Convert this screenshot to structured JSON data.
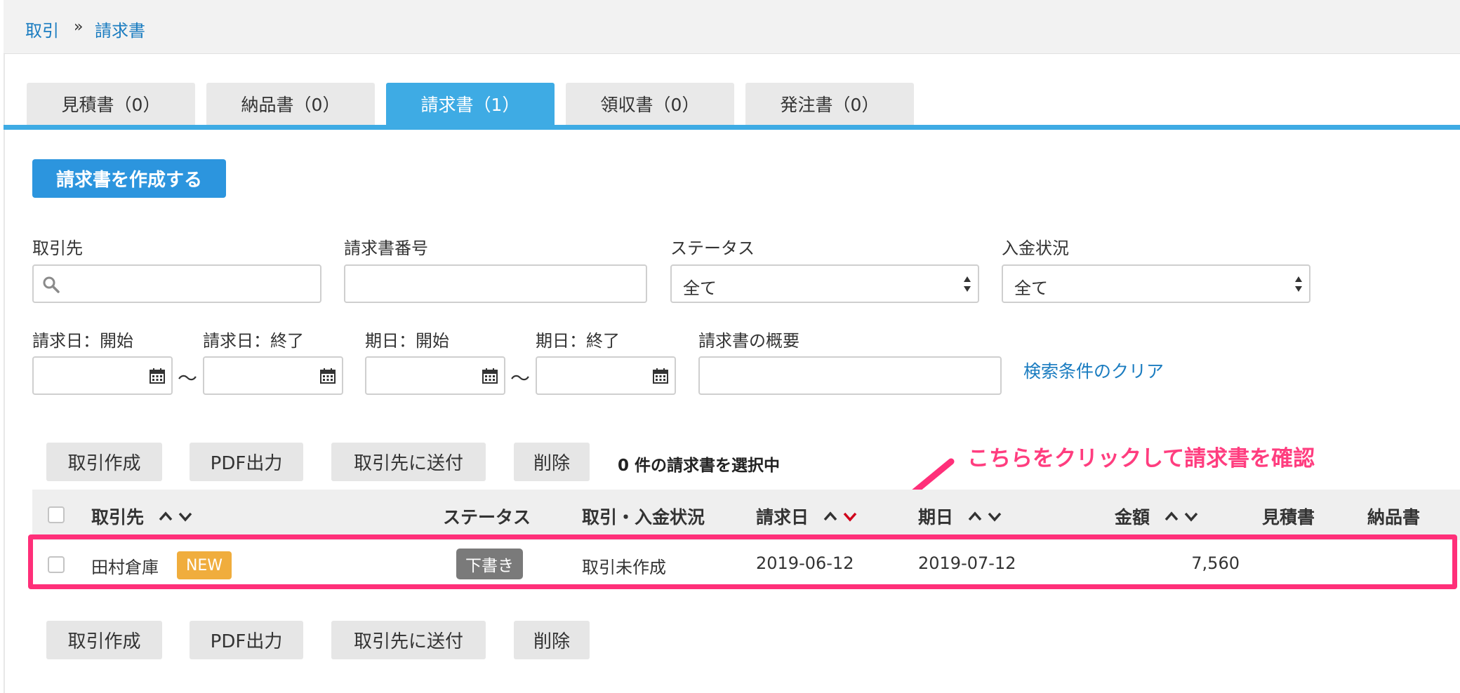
{
  "breadcrumb": {
    "item1": "取引",
    "separator": "»",
    "item2": "請求書"
  },
  "tabs": [
    {
      "label": "見積書（0）"
    },
    {
      "label": "納品書（0）"
    },
    {
      "label": "請求書（1）"
    },
    {
      "label": "領収書（0）"
    },
    {
      "label": "発注書（0）"
    }
  ],
  "create_button": "請求書を作成する",
  "filters": {
    "partner_label": "取引先",
    "partner_value": "",
    "number_label": "請求書番号",
    "number_value": "",
    "status_label": "ステータス",
    "status_value": "全て",
    "payment_label": "入金状況",
    "payment_value": "全て",
    "invoice_start_label": "請求日：開始",
    "invoice_end_label": "請求日：終了",
    "due_start_label": "期日：開始",
    "due_end_label": "期日：終了",
    "range_sep": "〜",
    "summary_label": "請求書の概要",
    "summary_value": "",
    "clear_link": "検索条件のクリア"
  },
  "actions": {
    "create_deal": "取引作成",
    "pdf": "PDF出力",
    "send": "取引先に送付",
    "delete": "削除",
    "selected_count": "0 件の請求書を選択中"
  },
  "annotation_text": "こちらをクリックして請求書を確認",
  "table": {
    "headers": {
      "partner": "取引先",
      "status": "ステータス",
      "deal_payment": "取引・入金状況",
      "invoice_date": "請求日",
      "due_date": "期日",
      "amount": "金額",
      "estimate": "見積書",
      "delivery": "納品書"
    },
    "rows": [
      {
        "partner": "田村倉庫",
        "new_badge": "NEW",
        "status": "下書き",
        "deal_payment": "取引未作成",
        "invoice_date": "2019-06-12",
        "due_date": "2019-07-12",
        "amount": "7,560"
      }
    ]
  },
  "colors": {
    "accent": "#3eabe4",
    "primary": "#2c95de",
    "link": "#1a7cc0",
    "annotation": "#ff2f79",
    "new_badge": "#f0ad3d",
    "draft_badge": "#7a7a7a"
  }
}
